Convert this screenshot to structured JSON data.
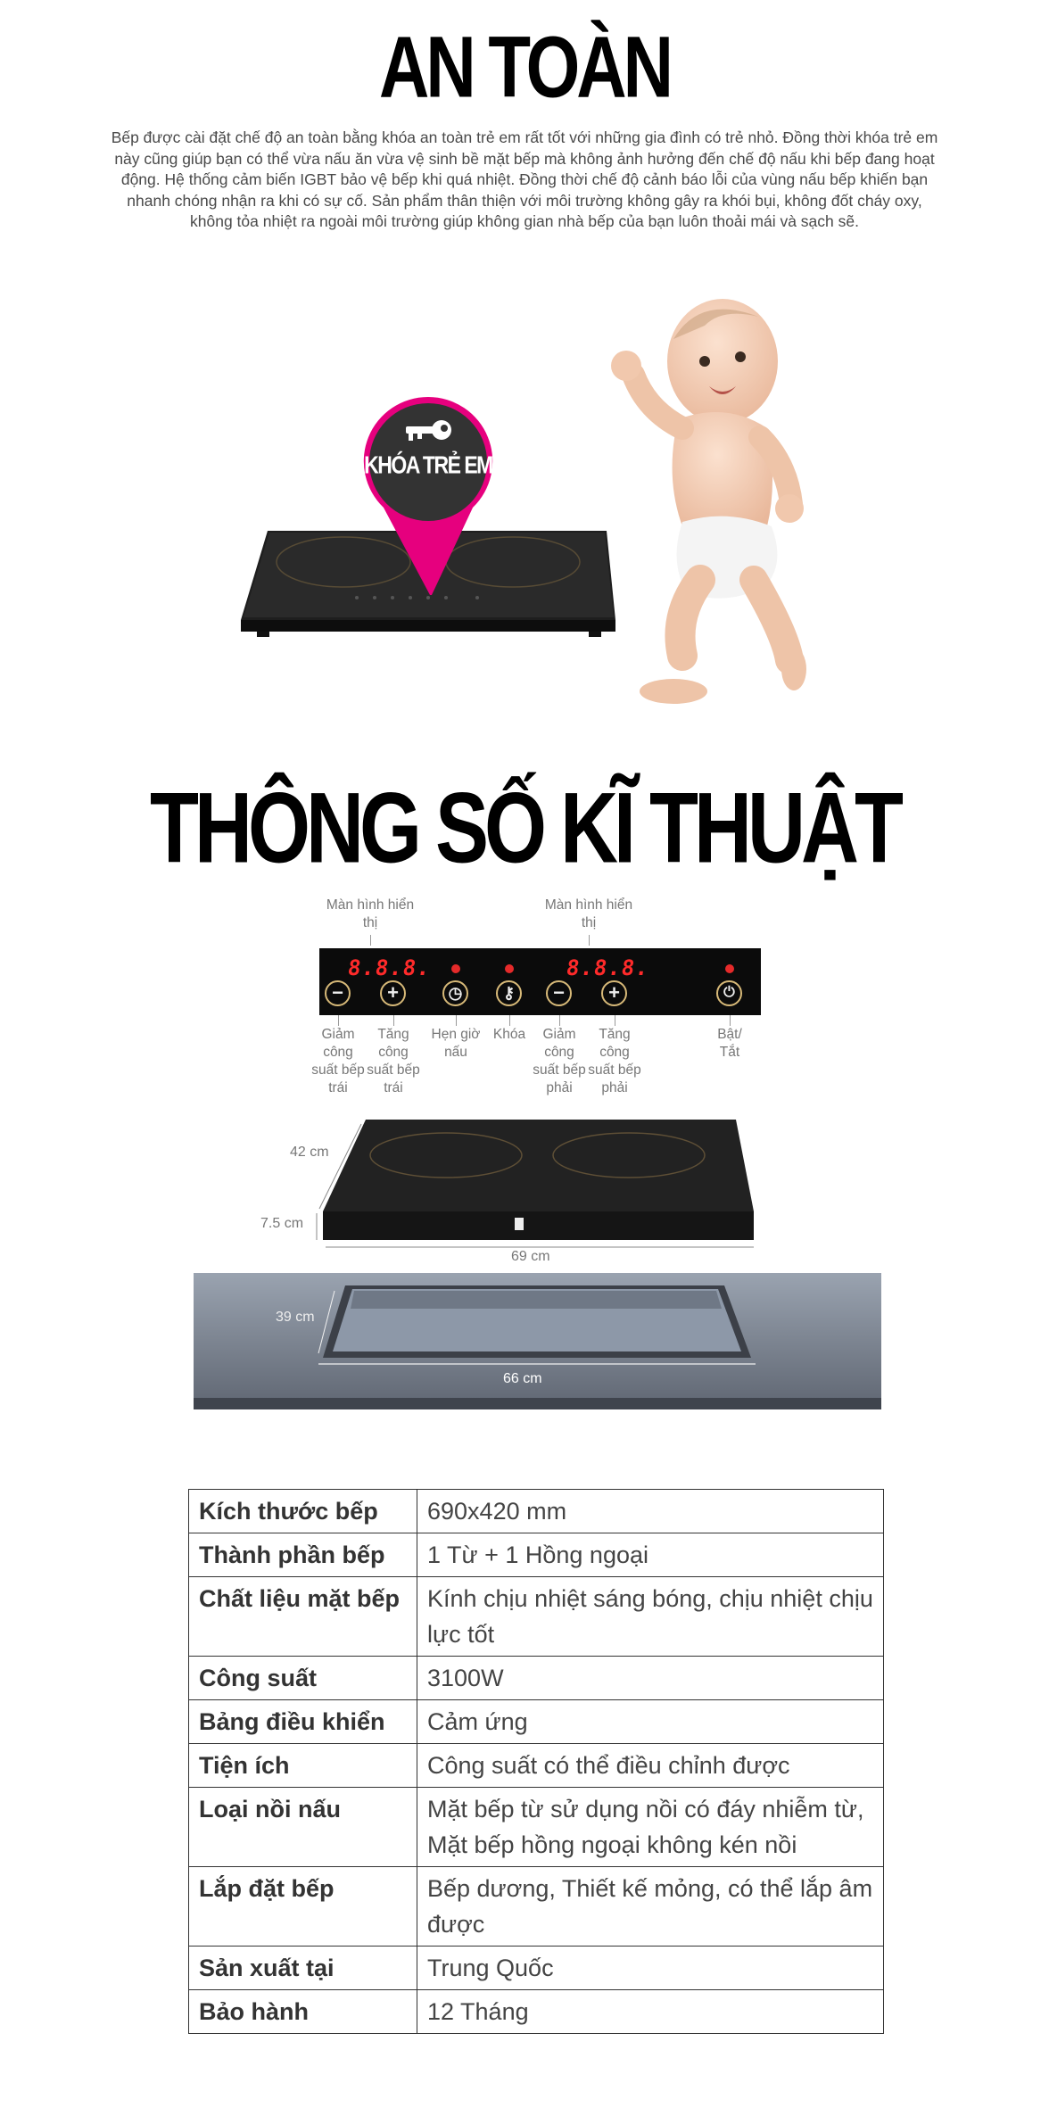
{
  "safety": {
    "title": "AN TOÀN",
    "paragraph": "Bếp được cài đặt chế độ an toàn bằng khóa an toàn trẻ em rất tốt với những gia đình có trẻ nhỏ. Đồng thời khóa trẻ em này cũng giúp bạn có thể vừa nấu ăn vừa vệ sinh bề mặt bếp mà không ảnh hưởng đến chế độ nấu khi bếp đang hoạt động. Hệ thống cảm biến IGBT bảo vệ bếp khi quá nhiệt. Đồng thời chế độ cảnh báo lỗi của vùng nấu bếp khiến bạn nhanh chóng nhận ra khi có sự cố. Sản phẩm thân thiện với môi trường không gây ra khói bụi, không đốt cháy oxy, không tỏa nhiệt ra ngoài môi trường giúp không gian nhà bếp của bạn luôn thoải mái và sạch sẽ.",
    "pin_label": "KHÓA TRẺ EM",
    "pin_color": "#e6007e",
    "pin_icon": "key-icon"
  },
  "specs": {
    "title": "THÔNG SỐ KĨ THUẬT",
    "panel": {
      "display_left_label": "Màn hình hiển thị",
      "display_right_label": "Màn hình hiển thị",
      "display_left_digits": "8.8.8.",
      "display_right_digits": "8.8.8.",
      "controls": [
        {
          "symbol": "−",
          "label": "Giảm công suất bếp trái"
        },
        {
          "symbol": "+",
          "label": "Tăng công suất bếp trái"
        },
        {
          "symbol": "◷",
          "label": "Hẹn giờ nấu"
        },
        {
          "symbol": "⚷",
          "label": "Khóa"
        },
        {
          "symbol": "−",
          "label": "Giảm công suất bếp phải"
        },
        {
          "symbol": "+",
          "label": "Tăng công suất bếp phải"
        },
        {
          "symbol": "⏻",
          "label": "Bật/ Tắt"
        }
      ]
    },
    "dimensions": {
      "depth": "42 cm",
      "height": "7.5 cm",
      "width": "69 cm",
      "cutout_depth": "39 cm",
      "cutout_width": "66 cm"
    },
    "table": [
      {
        "key": "Kích thước bếp",
        "value": "690x420 mm"
      },
      {
        "key": "Thành phần bếp",
        "value": "1 Từ + 1 Hồng ngoại"
      },
      {
        "key": "Chất liệu mặt bếp",
        "value": "Kính chịu nhiệt sáng bóng, chịu nhiệt chịu lực tốt"
      },
      {
        "key": "Công suất",
        "value": "3100W"
      },
      {
        "key": "Bảng điều khiển",
        "value": "Cảm ứng"
      },
      {
        "key": "Tiện ích",
        "value": "Công suất có thể điều chỉnh được"
      },
      {
        "key": "Loại nồi nấu",
        "value": "Mặt bếp từ sử dụng nồi có đáy nhiễm từ, Mặt bếp hồng ngoại không kén nồi"
      },
      {
        "key": "Lắp đặt bếp",
        "value": "Bếp dương, Thiết kế mỏng, có thể lắp âm được"
      },
      {
        "key": "Sản xuất tại",
        "value": "Trung Quốc"
      },
      {
        "key": "Bảo hành",
        "value": "12 Tháng"
      }
    ]
  }
}
